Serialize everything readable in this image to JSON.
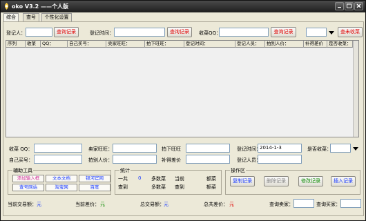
{
  "window": {
    "title": "oko V3.2  ——个人版"
  },
  "tabs": [
    {
      "label": "综合"
    },
    {
      "label": "查号"
    },
    {
      "label": "个性化设置"
    }
  ],
  "search": {
    "registrant_label": "登记人：",
    "search_btn_1": "查询记录",
    "reg_time_label": "登记时间：",
    "search_btn_2": "查询记录",
    "buyer_qq_label": "收菜QQ：",
    "search_btn_3": "查询记录",
    "uncollected_btn": "查未收菜"
  },
  "grid": {
    "columns": [
      "序列",
      "收菜",
      "QQ：",
      "自己买号：",
      "卖家旺旺：",
      "拍下旺旺：",
      "登记时间：",
      "登记人员：",
      "拍别人价：",
      "补得差价",
      "是否收菜："
    ]
  },
  "form": {
    "buyer_qq_label": "收菜  QQ：",
    "seller_ww_label": "卖家旺旺：",
    "buy_ww_label": "拍下旺旺",
    "reg_time_label": "登记时间：",
    "reg_time_value": "2014-1-3",
    "collected_label": "是否收菜：",
    "own_account_label": "自己买号：",
    "bid_price_label": "拍别人价：",
    "diff_label": "补得差价",
    "registrant_label": "登记人员："
  },
  "tools": {
    "title": "辅助工具",
    "buttons": [
      "添加输入框",
      "文本文档",
      "银河官网",
      "查号网站",
      "淘宝网",
      "百度"
    ]
  },
  "stats": {
    "title": "统计",
    "total_label": "一共",
    "total_value": "0",
    "multi_label_1": "多数菜",
    "current_label": "当前",
    "amount_label_1": "额菜",
    "found_label": "查到",
    "multi_label_2": "多数菜",
    "found_label_2": "查到",
    "amount_label_2": "额菜"
  },
  "ops": {
    "title": "操作区",
    "copy": "复制记录",
    "delete": "删除记录",
    "edit": "修改记录",
    "insert": "插入记录"
  },
  "status": {
    "current_amount_label": "当前交易额：",
    "current_amount_value": "元",
    "current_diff_label": "当前差价：",
    "current_diff_value": "元",
    "total_amount_label": "总交易额：",
    "total_amount_value": "元",
    "total_diff_label": "总共差价：",
    "total_diff_value": "元",
    "query_seller_label": "查询卖家：",
    "query_buyer_label": "查询买家："
  },
  "colors": {
    "red_text": "#e00000",
    "blue_text": "#1a3cff",
    "green_text": "#0a8a00",
    "pink_text": "#d0309a"
  }
}
